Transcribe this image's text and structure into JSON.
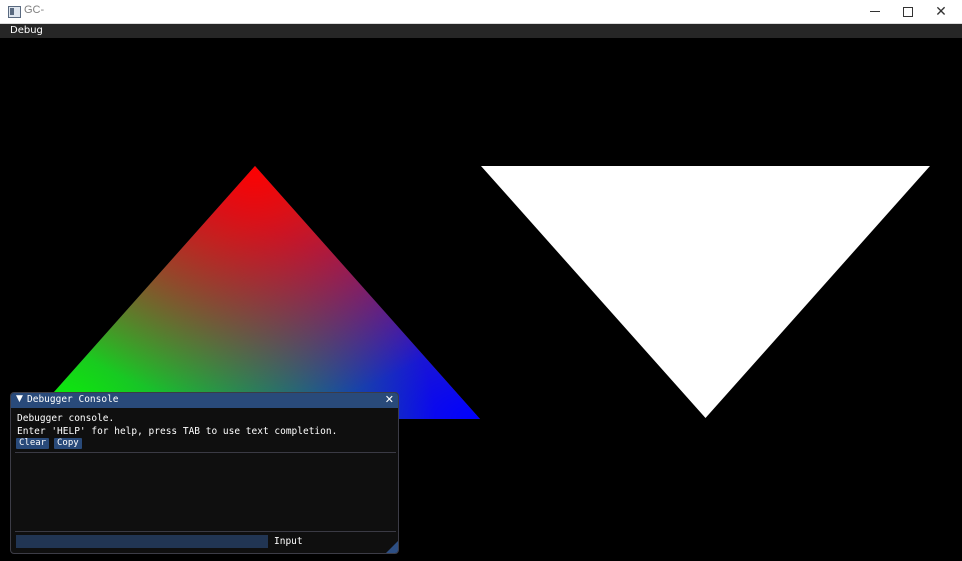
{
  "window": {
    "title": "GC-",
    "minimize_glyph": "",
    "maximize_glyph": "",
    "close_glyph": "✕"
  },
  "menu": {
    "items": [
      "Debug"
    ]
  },
  "scene": {
    "left_triangle_colors": {
      "top": "#ff0000",
      "bottom_left": "#00ff00",
      "bottom_right": "#0000ff"
    },
    "right_triangle_color": "#ffffff",
    "background": "#000000"
  },
  "console": {
    "title": "Debugger Console",
    "collapse_glyph": "▼",
    "close_glyph": "✕",
    "lines": [
      "Debugger console.",
      "Enter 'HELP' for help, press TAB to use text completion."
    ],
    "buttons": {
      "clear": "Clear",
      "copy": "Copy"
    },
    "input": {
      "value": "",
      "label": "Input"
    }
  }
}
